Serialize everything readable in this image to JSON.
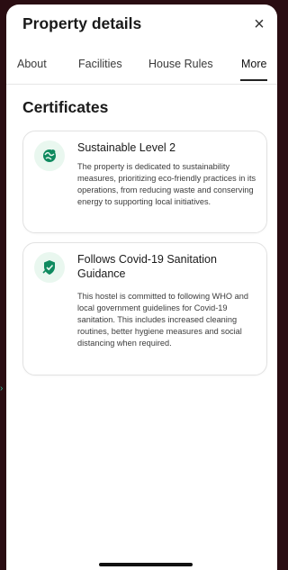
{
  "header": {
    "title": "Property details",
    "close_symbol": "×"
  },
  "tabs": [
    {
      "label": "About"
    },
    {
      "label": "Facilities"
    },
    {
      "label": "House Rules"
    },
    {
      "label": "More",
      "active": true
    }
  ],
  "section": {
    "title": "Certificates"
  },
  "certificates": [
    {
      "icon": "leaf-globe-icon",
      "title": "Sustainable Level 2",
      "body": "The property is dedicated to sustainability measures, prioritizing eco-friendly practices in its operations, from reducing waste and conserving energy to supporting local initiatives."
    },
    {
      "icon": "shield-sanitize-icon",
      "title": "Follows Covid-19 Sanitation Guidance",
      "body": "This hostel is committed to following WHO and local government guidelines for Covid-19 sanitation. This includes increased cleaning routines, better hygiene measures and social distancing when required."
    }
  ],
  "colors": {
    "accent": "#0f8a5f",
    "icon_bg": "#e9f7ef",
    "backdrop": "#2a0d12"
  }
}
